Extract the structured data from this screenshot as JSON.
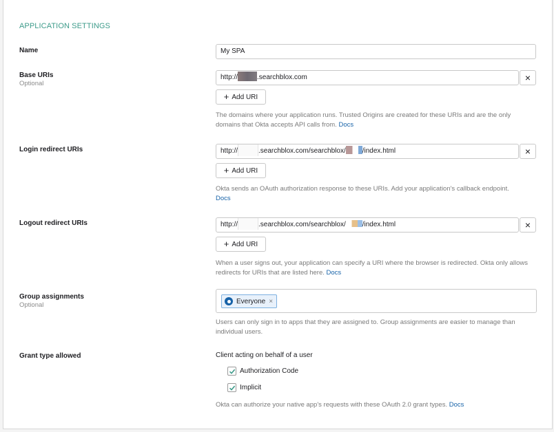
{
  "section_title": "APPLICATION SETTINGS",
  "name_field": {
    "label": "Name",
    "value": "My SPA"
  },
  "base_uris": {
    "label": "Base URIs",
    "optional": "Optional",
    "value_prefix": "http://",
    "value_suffix": ".searchblox.com",
    "add_label": "Add URI",
    "help": "The domains where your application runs. Trusted Origins are created for these URIs and are the only domains that Okta accepts API calls from.",
    "docs": "Docs"
  },
  "login_redirect": {
    "label": "Login redirect URIs",
    "value_prefix": "http://",
    "value_middle": ".searchblox.com/searchblox/",
    "value_suffix": "/index.html",
    "add_label": "Add URI",
    "help": "Okta sends an OAuth authorization response to these URIs. Add your application's callback endpoint.",
    "docs": "Docs"
  },
  "logout_redirect": {
    "label": "Logout redirect URIs",
    "value_prefix": "http://",
    "value_middle": ".searchblox.com/searchblox/",
    "value_suffix": "/index.html",
    "add_label": "Add URI",
    "help": "When a user signs out, your application can specify a URI where the browser is redirected. Okta only allows redirects for URIs that are listed here.",
    "docs": "Docs"
  },
  "group_assignments": {
    "label": "Group assignments",
    "optional": "Optional",
    "chip": "Everyone",
    "chip_remove": "×",
    "help": "Users can only sign in to apps that they are assigned to. Group assignments are easier to manage than individual users."
  },
  "grant_type": {
    "label": "Grant type allowed",
    "subheading": "Client acting on behalf of a user",
    "options": [
      {
        "label": "Authorization Code",
        "checked": true
      },
      {
        "label": "Implicit",
        "checked": true
      }
    ],
    "help": "Okta can authorize your native app's requests with these OAuth 2.0 grant types.",
    "docs": "Docs"
  },
  "remove_glyph": "×",
  "add_glyph": "+",
  "colors": {
    "accent_title": "#3d9b8a",
    "link": "#1662a8",
    "chip_bg": "#e8f1fb"
  }
}
